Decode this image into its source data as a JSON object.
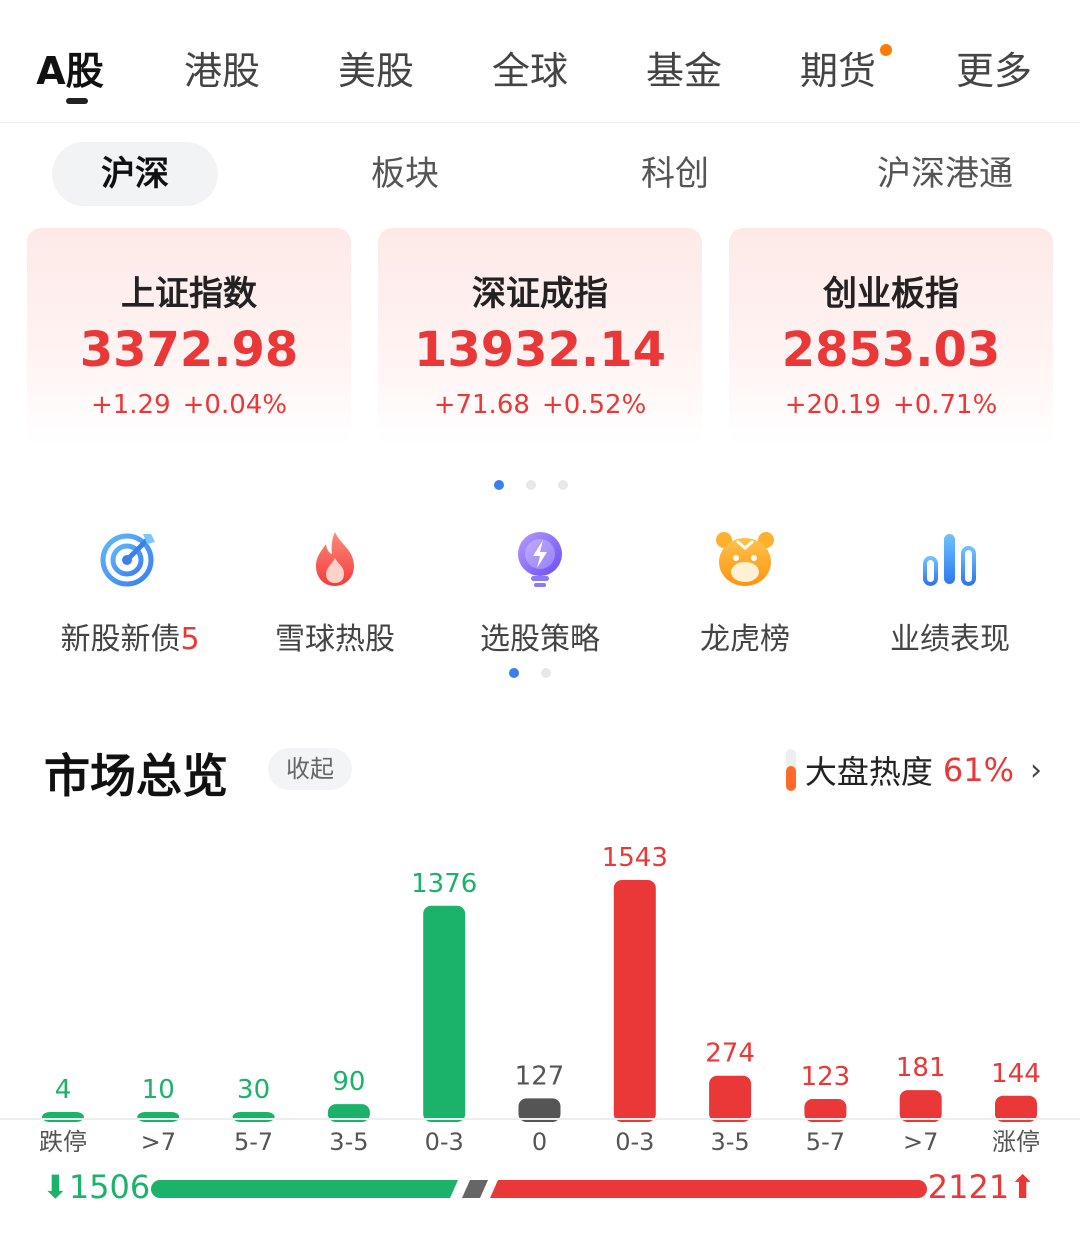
{
  "top_tabs": [
    {
      "label": "A股",
      "active": true
    },
    {
      "label": "港股"
    },
    {
      "label": "美股"
    },
    {
      "label": "全球"
    },
    {
      "label": "基金"
    },
    {
      "label": "期货",
      "has_dot": true
    },
    {
      "label": "更多"
    }
  ],
  "sub_tabs": [
    {
      "label": "沪深",
      "active": true
    },
    {
      "label": "板块"
    },
    {
      "label": "科创"
    },
    {
      "label": "沪深港通"
    }
  ],
  "indices": [
    {
      "name": "上证指数",
      "value": "3372.98",
      "change": "+1.29",
      "pct": "+0.04%"
    },
    {
      "name": "深证成指",
      "value": "13932.14",
      "change": "+71.68",
      "pct": "+0.52%"
    },
    {
      "name": "创业板指",
      "value": "2853.03",
      "change": "+20.19",
      "pct": "+0.71%"
    }
  ],
  "quick_entries": [
    {
      "label": "新股新债",
      "badge": "5",
      "icon": "target-icon"
    },
    {
      "label": "雪球热股",
      "badge": "",
      "icon": "flame-icon"
    },
    {
      "label": "选股策略",
      "badge": "",
      "icon": "lightbulb-icon"
    },
    {
      "label": "龙虎榜",
      "badge": "",
      "icon": "tiger-icon"
    },
    {
      "label": "业绩表现",
      "badge": "",
      "icon": "bar-chart-icon"
    }
  ],
  "market_overview": {
    "title": "市场总览",
    "collapse_label": "收起",
    "heat_label": "大盘热度",
    "heat_value": "61%",
    "down_total": "1506",
    "up_total": "2121"
  },
  "colors": {
    "up": "#ea3838",
    "down": "#1bb36a",
    "flat": "#555555",
    "accent": "#3a7ff0"
  },
  "chart_data": {
    "type": "bar",
    "categories": [
      "跌停",
      ">7",
      "5-7",
      "3-5",
      "0-3",
      "0",
      "0-3",
      "3-5",
      "5-7",
      ">7",
      "涨停"
    ],
    "values": [
      4,
      10,
      30,
      90,
      1376,
      127,
      1543,
      274,
      123,
      181,
      144
    ],
    "colors": [
      "down",
      "down",
      "down",
      "down",
      "down",
      "flat",
      "up",
      "up",
      "up",
      "up",
      "up"
    ]
  }
}
